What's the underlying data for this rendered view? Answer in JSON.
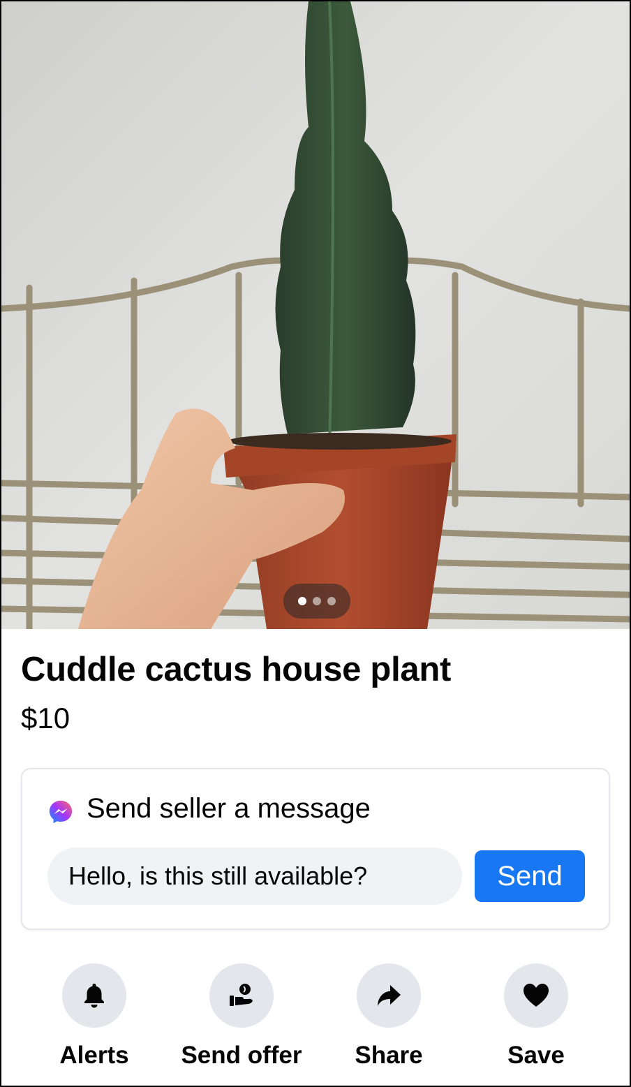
{
  "listing": {
    "title": "Cuddle cactus house plant",
    "price": "$10",
    "photo_count": 3,
    "active_photo_index": 0
  },
  "message": {
    "heading": "Send seller a message",
    "input_value": "Hello, is this still available?",
    "send_label": "Send"
  },
  "actions": [
    {
      "label": "Alerts",
      "icon": "bell-icon"
    },
    {
      "label": "Send offer",
      "icon": "offer-icon"
    },
    {
      "label": "Share",
      "icon": "share-arrow-icon"
    },
    {
      "label": "Save",
      "icon": "heart-icon"
    }
  ],
  "colors": {
    "accent": "#1877f2",
    "input_bg": "#f0f2f5",
    "icon_circle_bg": "#e4e6eb",
    "text": "#050505"
  }
}
